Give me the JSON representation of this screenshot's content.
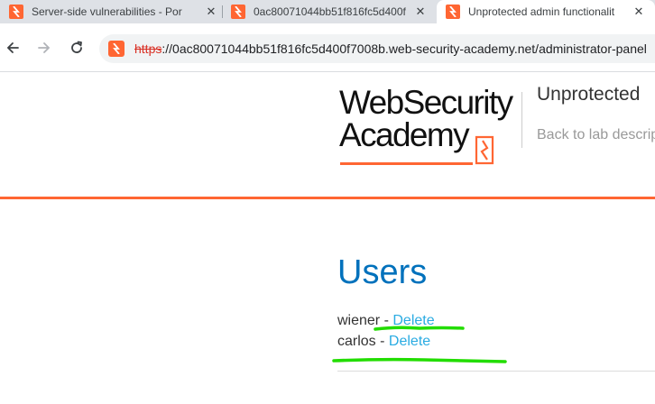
{
  "browser": {
    "tabs": [
      {
        "title": "Server-side vulnerabilities - Por",
        "active": false
      },
      {
        "title": "0ac80071044bb51f816fc5d400f",
        "active": false
      },
      {
        "title": "Unprotected admin functionalit",
        "active": true
      }
    ],
    "close_glyph": "✕",
    "address": {
      "scheme": "https",
      "rest": "://0ac80071044bb51f816fc5d400f7008b.web-security-academy.net/administrator-panel"
    }
  },
  "header": {
    "logo_line1": "WebSecurity",
    "logo_line2": "Academy",
    "lab_title": "Unprotected",
    "back_link": "Back to lab descrip"
  },
  "main": {
    "heading": "Users",
    "users": [
      {
        "name": "wiener",
        "separator": " - ",
        "action": "Delete"
      },
      {
        "name": "carlos",
        "separator": " - ",
        "action": "Delete"
      }
    ]
  },
  "colors": {
    "accent_orange": "#ff6633",
    "heading_blue": "#0071bc",
    "link_blue": "#29abe2",
    "annotation_green": "#22dd00"
  },
  "icons": {
    "tab_favicon": "portswigger-lightning-icon",
    "back": "arrow-left-icon",
    "forward": "arrow-right-icon",
    "reload": "reload-icon",
    "site_info": "portswigger-lightning-icon"
  }
}
